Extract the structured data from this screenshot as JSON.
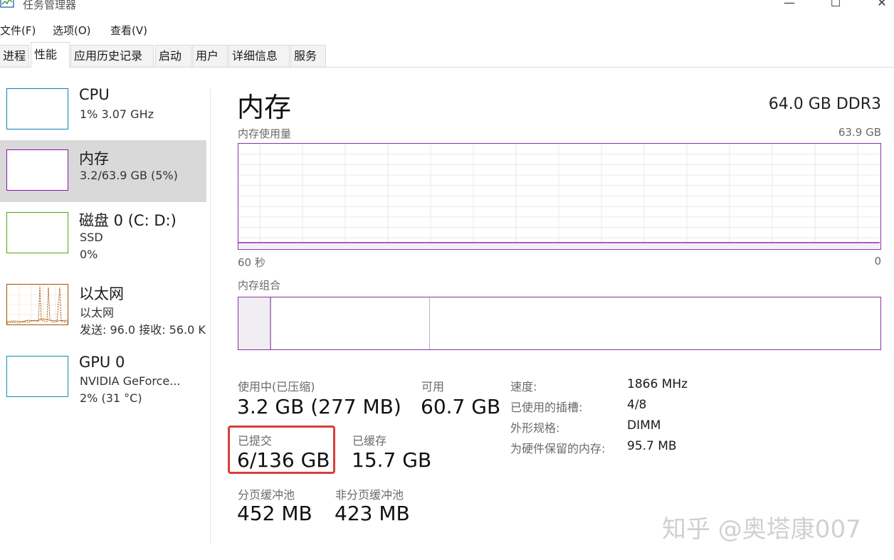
{
  "window": {
    "title": "任务管理器",
    "minimize_glyph": "—",
    "maximize_glyph": "☐",
    "close_glyph": "✕"
  },
  "menu": {
    "file": "文件(F)",
    "options": "选项(O)",
    "view": "查看(V)"
  },
  "tabs": [
    {
      "label": "进程"
    },
    {
      "label": "性能"
    },
    {
      "label": "应用历史记录"
    },
    {
      "label": "启动"
    },
    {
      "label": "用户"
    },
    {
      "label": "详细信息"
    },
    {
      "label": "服务"
    }
  ],
  "sidebar": {
    "items": [
      {
        "title": "CPU",
        "line1": "1% 3.07 GHz",
        "line2": "",
        "color": "#117dbb"
      },
      {
        "title": "内存",
        "line1": "3.2/63.9 GB (5%)",
        "line2": "",
        "color": "#8b12ae"
      },
      {
        "title": "磁盘 0 (C: D:)",
        "line1": "SSD",
        "line2": "0%",
        "color": "#4da60c"
      },
      {
        "title": "以太网",
        "line1": "以太网",
        "line2": "发送: 96.0 接收: 56.0 K",
        "color": "#a74f01"
      },
      {
        "title": "GPU 0",
        "line1": "NVIDIA GeForce...",
        "line2": "2% (31 °C)",
        "color": "#0f8eb5"
      }
    ]
  },
  "memory": {
    "title": "内存",
    "spec": "64.0 GB DDR3",
    "usage_label": "内存使用量",
    "usage_max": "63.9 GB",
    "time_left": "60 秒",
    "time_right": "0",
    "composition_label": "内存组合",
    "accent_color": "#8b2fa3",
    "stats": {
      "in_use_label": "使用中(已压缩)",
      "in_use_value": "3.2 GB (277 MB)",
      "available_label": "可用",
      "available_value": "60.7 GB",
      "committed_label": "已提交",
      "committed_value": "6/136 GB",
      "cached_label": "已缓存",
      "cached_value": "15.7 GB",
      "paged_label": "分页缓冲池",
      "paged_value": "452 MB",
      "nonpaged_label": "非分页缓冲池",
      "nonpaged_value": "423 MB"
    },
    "specs": {
      "speed_label": "速度:",
      "speed_value": "1866 MHz",
      "slots_label": "已使用的插槽:",
      "slots_value": "4/8",
      "form_label": "外形规格:",
      "form_value": "DIMM",
      "reserved_label": "为硬件保留的内存:",
      "reserved_value": "95.7 MB"
    }
  },
  "watermark": "知乎 @奥塔康007"
}
